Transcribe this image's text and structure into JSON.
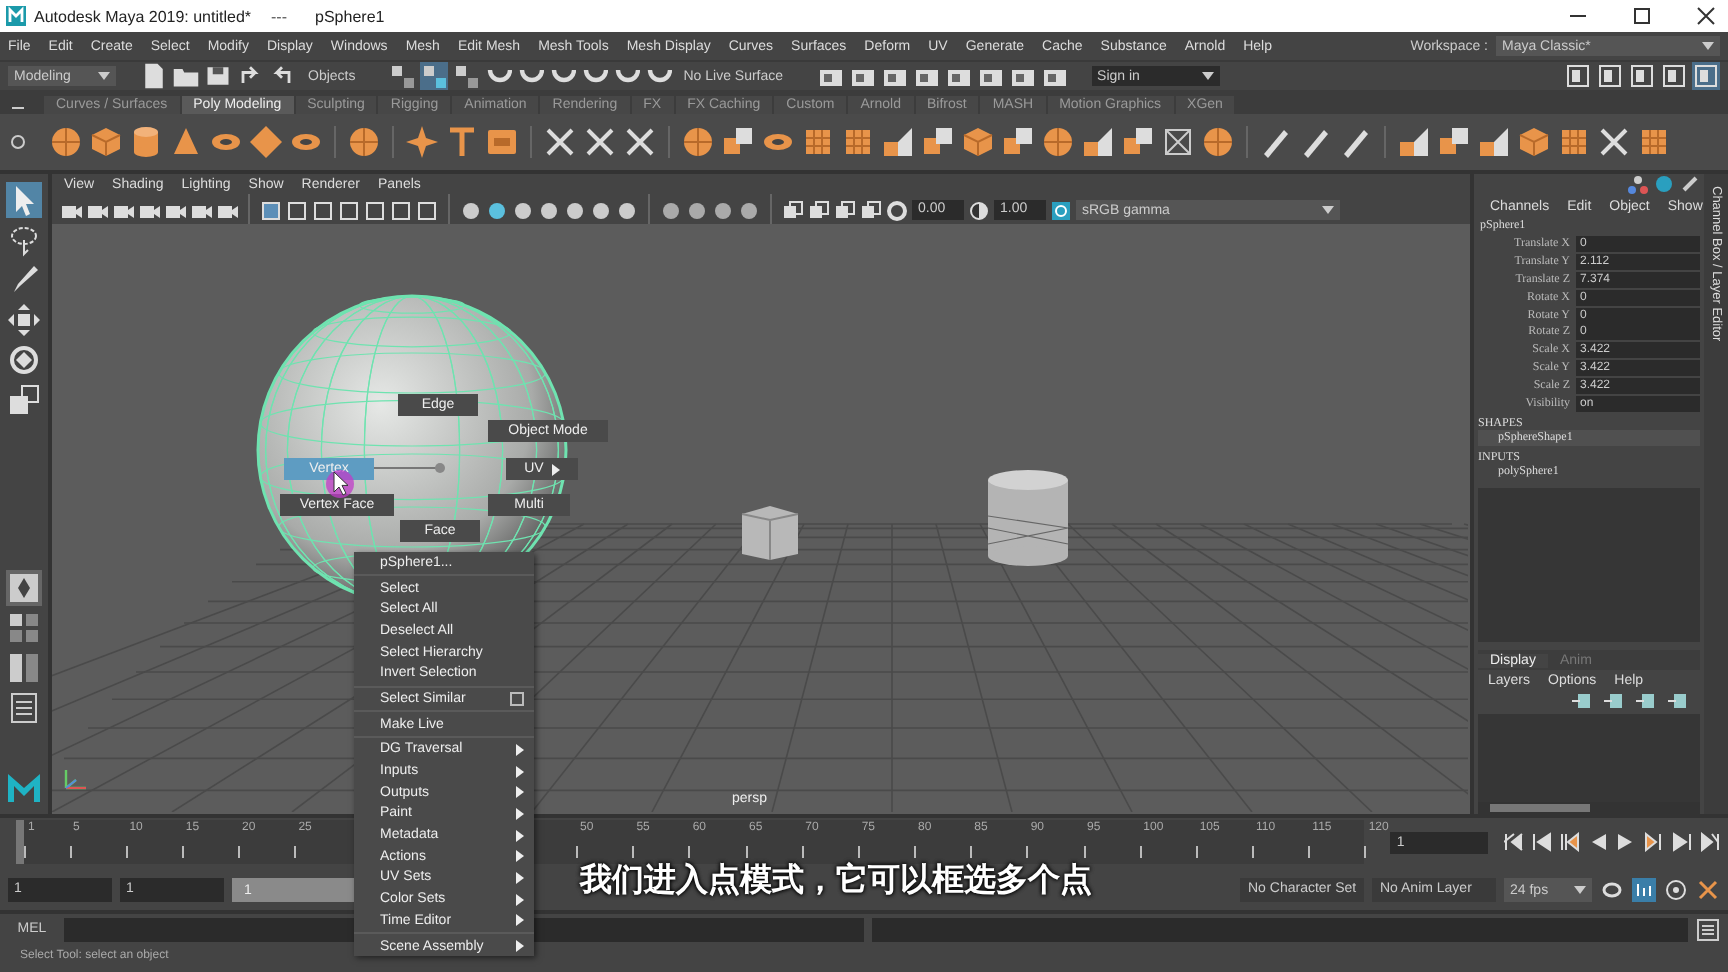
{
  "window": {
    "app_title": "Autodesk Maya 2019: untitled*",
    "separator": "---",
    "scene": "pSphere1"
  },
  "menu_bar": [
    "File",
    "Edit",
    "Create",
    "Select",
    "Modify",
    "Display",
    "Windows",
    "Mesh",
    "Edit Mesh",
    "Mesh Tools",
    "Mesh Display",
    "Curves",
    "Surfaces",
    "Deform",
    "UV",
    "Generate",
    "Cache",
    "Substance",
    "Arnold",
    "Help"
  ],
  "status_line": {
    "mode": "Modeling",
    "selection_mask": "Objects",
    "live_surface": "No Live Surface",
    "sign_in": "Sign in",
    "workspace_label": "Workspace :",
    "workspace": "Maya Classic*"
  },
  "shelf_tabs": [
    {
      "label": "Curves / Surfaces",
      "selected": false
    },
    {
      "label": "Poly Modeling",
      "selected": true
    },
    {
      "label": "Sculpting",
      "selected": false
    },
    {
      "label": "Rigging",
      "selected": false
    },
    {
      "label": "Animation",
      "selected": false
    },
    {
      "label": "Rendering",
      "selected": false
    },
    {
      "label": "FX",
      "selected": false
    },
    {
      "label": "FX Caching",
      "selected": false
    },
    {
      "label": "Custom",
      "selected": false
    },
    {
      "label": "Arnold",
      "selected": false
    },
    {
      "label": "Bifrost",
      "selected": false
    },
    {
      "label": "MASH",
      "selected": false
    },
    {
      "label": "Motion Graphics",
      "selected": false
    },
    {
      "label": "XGen",
      "selected": false
    }
  ],
  "viewport": {
    "menus": [
      "View",
      "Shading",
      "Lighting",
      "Show",
      "Renderer",
      "Panels"
    ],
    "exposure": "0.00",
    "gamma": "1.00",
    "color_space": "sRGB gamma",
    "camera": "persp"
  },
  "marking_menu": [
    {
      "label": "Edge",
      "selected": false,
      "submenu": false
    },
    {
      "label": "Object Mode",
      "selected": false,
      "submenu": false
    },
    {
      "label": "UV",
      "selected": false,
      "submenu": true
    },
    {
      "label": "Multi",
      "selected": false,
      "submenu": false
    },
    {
      "label": "Face",
      "selected": false,
      "submenu": false
    },
    {
      "label": "Vertex Face",
      "selected": false,
      "submenu": false
    },
    {
      "label": "Vertex",
      "selected": true,
      "submenu": false
    }
  ],
  "context_menu": [
    [
      {
        "label": "pSphere1...",
        "submenu": false,
        "option_box": false
      }
    ],
    [
      {
        "label": "Select",
        "submenu": false,
        "option_box": false
      },
      {
        "label": "Select All",
        "submenu": false,
        "option_box": false
      },
      {
        "label": "Deselect All",
        "submenu": false,
        "option_box": false
      },
      {
        "label": "Select Hierarchy",
        "submenu": false,
        "option_box": false
      },
      {
        "label": "Invert Selection",
        "submenu": false,
        "option_box": false
      }
    ],
    [
      {
        "label": "Select Similar",
        "submenu": false,
        "option_box": true
      }
    ],
    [
      {
        "label": "Make Live",
        "submenu": false,
        "option_box": false
      }
    ],
    [
      {
        "label": "DG Traversal",
        "submenu": true,
        "option_box": false
      },
      {
        "label": "Inputs",
        "submenu": true,
        "option_box": false
      },
      {
        "label": "Outputs",
        "submenu": true,
        "option_box": false
      },
      {
        "label": "Paint",
        "submenu": true,
        "option_box": false
      },
      {
        "label": "Metadata",
        "submenu": true,
        "option_box": false
      },
      {
        "label": "Actions",
        "submenu": true,
        "option_box": false
      },
      {
        "label": "UV Sets",
        "submenu": true,
        "option_box": false
      },
      {
        "label": "Color Sets",
        "submenu": true,
        "option_box": false
      },
      {
        "label": "Time Editor",
        "submenu": true,
        "option_box": false
      }
    ],
    [
      {
        "label": "Scene Assembly",
        "submenu": true,
        "option_box": false
      }
    ]
  ],
  "channel_box": {
    "menus": [
      "Channels",
      "Edit",
      "Object",
      "Show"
    ],
    "object": "pSphere1",
    "channels": [
      {
        "name": "Translate X",
        "value": "0"
      },
      {
        "name": "Translate Y",
        "value": "2.112"
      },
      {
        "name": "Translate Z",
        "value": "7.374"
      },
      {
        "name": "Rotate X",
        "value": "0"
      },
      {
        "name": "Rotate Y",
        "value": "0"
      },
      {
        "name": "Rotate Z",
        "value": "0"
      },
      {
        "name": "Scale X",
        "value": "3.422"
      },
      {
        "name": "Scale Y",
        "value": "3.422"
      },
      {
        "name": "Scale Z",
        "value": "3.422"
      },
      {
        "name": "Visibility",
        "value": "on"
      }
    ],
    "shapes_heading": "SHAPES",
    "shape": "pSphereShape1",
    "inputs_heading": "INPUTS",
    "input": "polySphere1",
    "side_tab": "Channel Box / Layer Editor"
  },
  "layer_editor": {
    "tabs": [
      {
        "label": "Display",
        "selected": true
      },
      {
        "label": "Anim",
        "selected": false
      }
    ],
    "menus": [
      "Layers",
      "Options",
      "Help"
    ]
  },
  "timeline": {
    "level": 0,
    "ticks": [
      "1",
      "5",
      "10",
      "15",
      "20",
      "25",
      "50",
      "55",
      "60",
      "65",
      "70",
      "75",
      "80",
      "85",
      "90",
      "95",
      "100",
      "105",
      "110",
      "115",
      "120"
    ],
    "current_frame": "1"
  },
  "range": {
    "level": 1,
    "start": "1",
    "playback_start": "1",
    "slider_start": "1",
    "character_set": "No Character Set",
    "anim_layer": "No Anim Layer",
    "fps": "24 fps"
  },
  "command_line": {
    "label": "MEL"
  },
  "help_line": "Select Tool: select an object",
  "subtitle": "我们进入点模式，它可以框选多个点"
}
